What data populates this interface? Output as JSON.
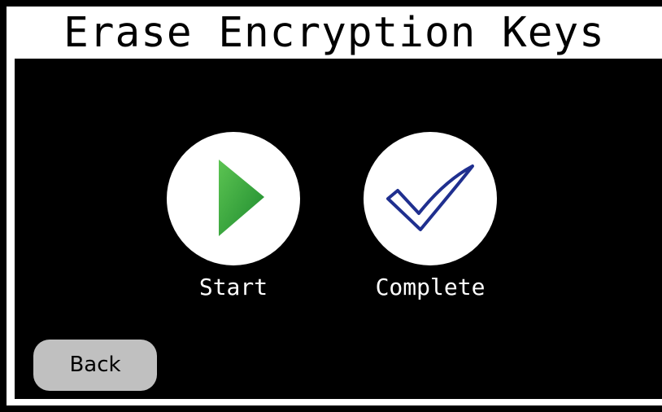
{
  "header": {
    "title": "Erase Encryption Keys"
  },
  "actions": [
    {
      "label": "Start",
      "icon": "play-icon",
      "color": "#2e9e3a"
    },
    {
      "label": "Complete",
      "icon": "checkmark-icon",
      "color": "#1f2f8f"
    }
  ],
  "footer": {
    "back_label": "Back"
  },
  "colors": {
    "background": "#000000",
    "frame": "#ffffff",
    "button_gray": "#c0c0c0"
  }
}
